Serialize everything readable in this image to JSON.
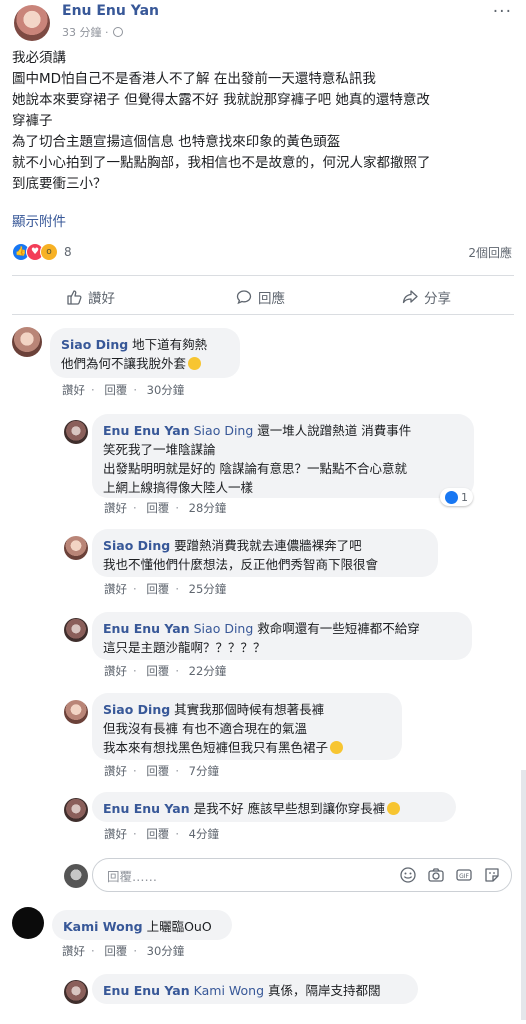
{
  "post": {
    "author": "Enu Enu Yan",
    "time": "33 分鐘 · ",
    "body_lines": [
      "我必須講",
      "圖中MD怕自己不是香港人不了解 在出發前一天還特意私訊我",
      "她說本來要穿裙子 但覺得太露不好 我就說那穿褲子吧 她真的還特意改",
      "穿褲子",
      "為了切合主題宣揚這個信息 也特意找來印象的黃色頭盔",
      "就不小心拍到了一點點胸部，我相信也不是故意的，何況人家都撤照了",
      "到底要衝三小？"
    ],
    "show_attachments": "顯示附件",
    "reaction_count": "8",
    "comment_count": "2個回應",
    "actions": {
      "like": "讚好",
      "comment": "回應",
      "share": "分享"
    }
  },
  "comments": [
    {
      "name": "Siao Ding",
      "lines": [
        "地下道有夠熱",
        "他們為何不讓我脫外套"
      ],
      "like": "讚好",
      "reply": "回覆",
      "time": "30分鐘"
    },
    {
      "name": "Enu Enu Yan",
      "mention": "Siao Ding",
      "lines": [
        "還一堆人說蹭熱道 消費事件",
        "笑死我了一堆陰謀論",
        "出發點明明就是好的 陰謀論有意思？一點點不合心意就",
        "上網上線搞得像大陸人一樣"
      ],
      "reaction_count": "1",
      "like": "讚好",
      "reply": "回覆",
      "time": "28分鐘"
    },
    {
      "name": "Siao Ding",
      "lines": [
        "要蹭熱消費我就去連儂牆裸奔了吧",
        "我也不懂他們什麼想法，反正他們秀智商下限很會"
      ],
      "like": "讚好",
      "reply": "回覆",
      "time": "25分鐘"
    },
    {
      "name": "Enu Enu Yan",
      "mention": "Siao Ding",
      "lines": [
        "救命啊還有一些短褲都不給穿",
        "這只是主題沙龍啊？？？？？"
      ],
      "like": "讚好",
      "reply": "回覆",
      "time": "22分鐘"
    },
    {
      "name": "Siao Ding",
      "lines": [
        "其實我那個時候有想著長褲",
        "但我沒有長褲 有也不適合現在的氣溫",
        "我本來有想找黑色短褲但我只有黑色裙子"
      ],
      "like": "讚好",
      "reply": "回覆",
      "time": "7分鐘"
    },
    {
      "name": "Enu Enu Yan",
      "lines": [
        "是我不好 應該早些想到讓你穿長褲"
      ],
      "like": "讚好",
      "reply": "回覆",
      "time": "4分鐘"
    },
    {
      "name": "Kami Wong",
      "lines": [
        "上曬臨OuO"
      ],
      "like": "讚好",
      "reply": "回覆",
      "time": "30分鐘"
    },
    {
      "name": "Enu Enu Yan",
      "mention": "Kami Wong",
      "lines": [
        "真係，隔岸支持都闊"
      ]
    }
  ],
  "composer": {
    "placeholder": "回覆……"
  }
}
